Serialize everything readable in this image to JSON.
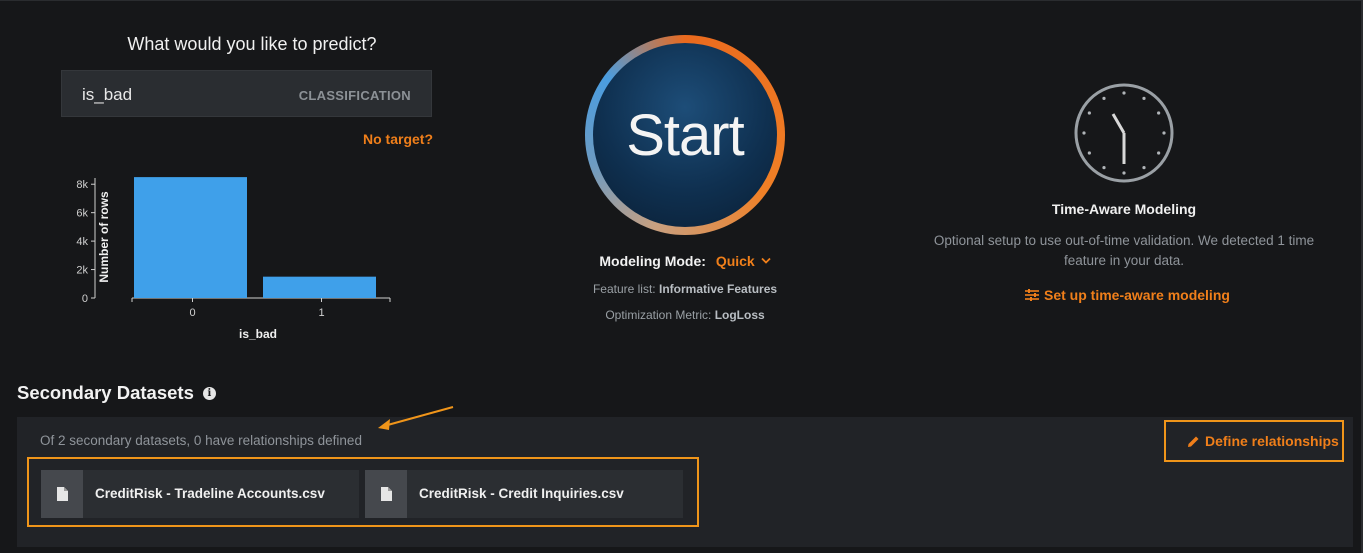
{
  "target": {
    "question": "What would you like to predict?",
    "value": "is_bad",
    "type": "CLASSIFICATION",
    "no_target": "No target?"
  },
  "chart_data": {
    "type": "bar",
    "categories": [
      "0",
      "1"
    ],
    "values": [
      8500,
      1500
    ],
    "xlabel": "is_bad",
    "ylabel": "Number of rows",
    "yticks": [
      "0",
      "2k",
      "4k",
      "6k",
      "8k"
    ],
    "ylim": [
      0,
      9000
    ]
  },
  "start": {
    "label": "Start",
    "mode_label": "Modeling Mode:",
    "mode_value": "Quick",
    "feature_list_label": "Feature list:",
    "feature_list_value": "Informative Features",
    "metric_label": "Optimization Metric:",
    "metric_value": "LogLoss"
  },
  "time_aware": {
    "title": "Time-Aware Modeling",
    "description": "Optional setup to use out-of-time validation. We detected 1 time feature in your data.",
    "link": "Set up time-aware modeling"
  },
  "secondary": {
    "title": "Secondary Datasets",
    "summary": "Of 2 secondary datasets, 0 have relationships defined",
    "define_link": "Define relationships",
    "files": [
      {
        "name": "CreditRisk - Tradeline Accounts.csv"
      },
      {
        "name": "CreditRisk - Credit Inquiries.csv"
      }
    ]
  },
  "colors": {
    "accent": "#f07f1a",
    "bar": "#3fa0ea",
    "highlight": "#f0951a"
  },
  "icons": {
    "clock": "clock-icon",
    "settings": "sliders-icon",
    "info": "info-icon",
    "edit": "pencil-icon",
    "file": "file-icon",
    "dropdown": "chevron-down-icon"
  }
}
